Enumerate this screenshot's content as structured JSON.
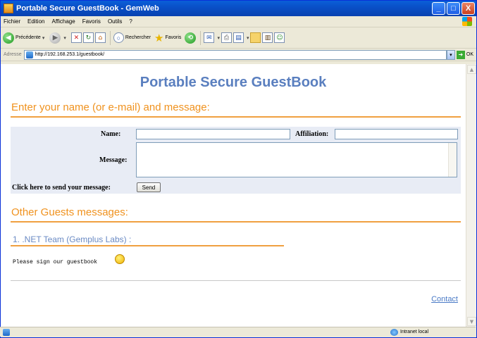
{
  "window": {
    "title": "Portable Secure GuestBook - GemWeb",
    "buttons": [
      "_",
      "□",
      "X"
    ]
  },
  "menu": [
    "Fichier",
    "Edition",
    "Affichage",
    "Favoris",
    "Outils",
    "?"
  ],
  "toolbar": {
    "back_label": "Précédente",
    "search_label": "Rechercher",
    "favorites_label": "Favoris"
  },
  "address": {
    "label": "Adresse",
    "url": "http://192.168.253.1/guestbook/",
    "go_label": "OK"
  },
  "page": {
    "title": "Portable Secure GuestBook",
    "enter_heading": "Enter your name (or e-mail) and message:",
    "form": {
      "name_label": "Name:",
      "name_value": "",
      "affiliation_label": "Affiliation:",
      "affiliation_value": "",
      "message_label": "Message:",
      "message_value": "",
      "send_prompt": "Click here to send your message:",
      "send_button": "Send"
    },
    "others_heading": "Other Guests messages:",
    "entries": [
      {
        "title": "1. .NET Team (Gemplus Labs) :",
        "message": "Please sign our guestbook"
      }
    ],
    "contact_link": "Contact"
  },
  "status": {
    "zone": "Intranet local"
  },
  "colors": {
    "heading_orange": "#f0921e",
    "title_blue": "#5a7fbf",
    "link_blue": "#4a7ac6",
    "form_bg": "#e8ecf5"
  }
}
